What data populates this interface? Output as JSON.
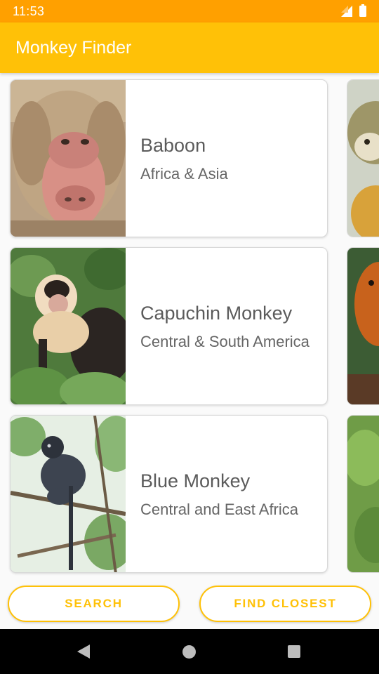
{
  "status_bar": {
    "time": "11:53",
    "icons": [
      "signal-icon",
      "battery-icon"
    ]
  },
  "app_bar": {
    "title": "Monkey Finder",
    "color": "#ffc107"
  },
  "monkeys": [
    {
      "name": "Baboon",
      "location": "Africa & Asia",
      "image": "baboon-photo"
    },
    {
      "name": "Capuchin Monkey",
      "location": "Central & South America",
      "image": "capuchin-photo"
    },
    {
      "name": "Blue Monkey",
      "location": "Central and East Africa",
      "image": "blue-monkey-photo"
    }
  ],
  "buttons": {
    "search_label": "SEARCH",
    "find_closest_label": "FIND CLOSEST"
  },
  "nav_bar": {
    "icons": [
      "back-icon",
      "home-icon",
      "recents-icon"
    ]
  },
  "colors": {
    "status_bar": "#ffa000",
    "accent": "#ffc107"
  }
}
